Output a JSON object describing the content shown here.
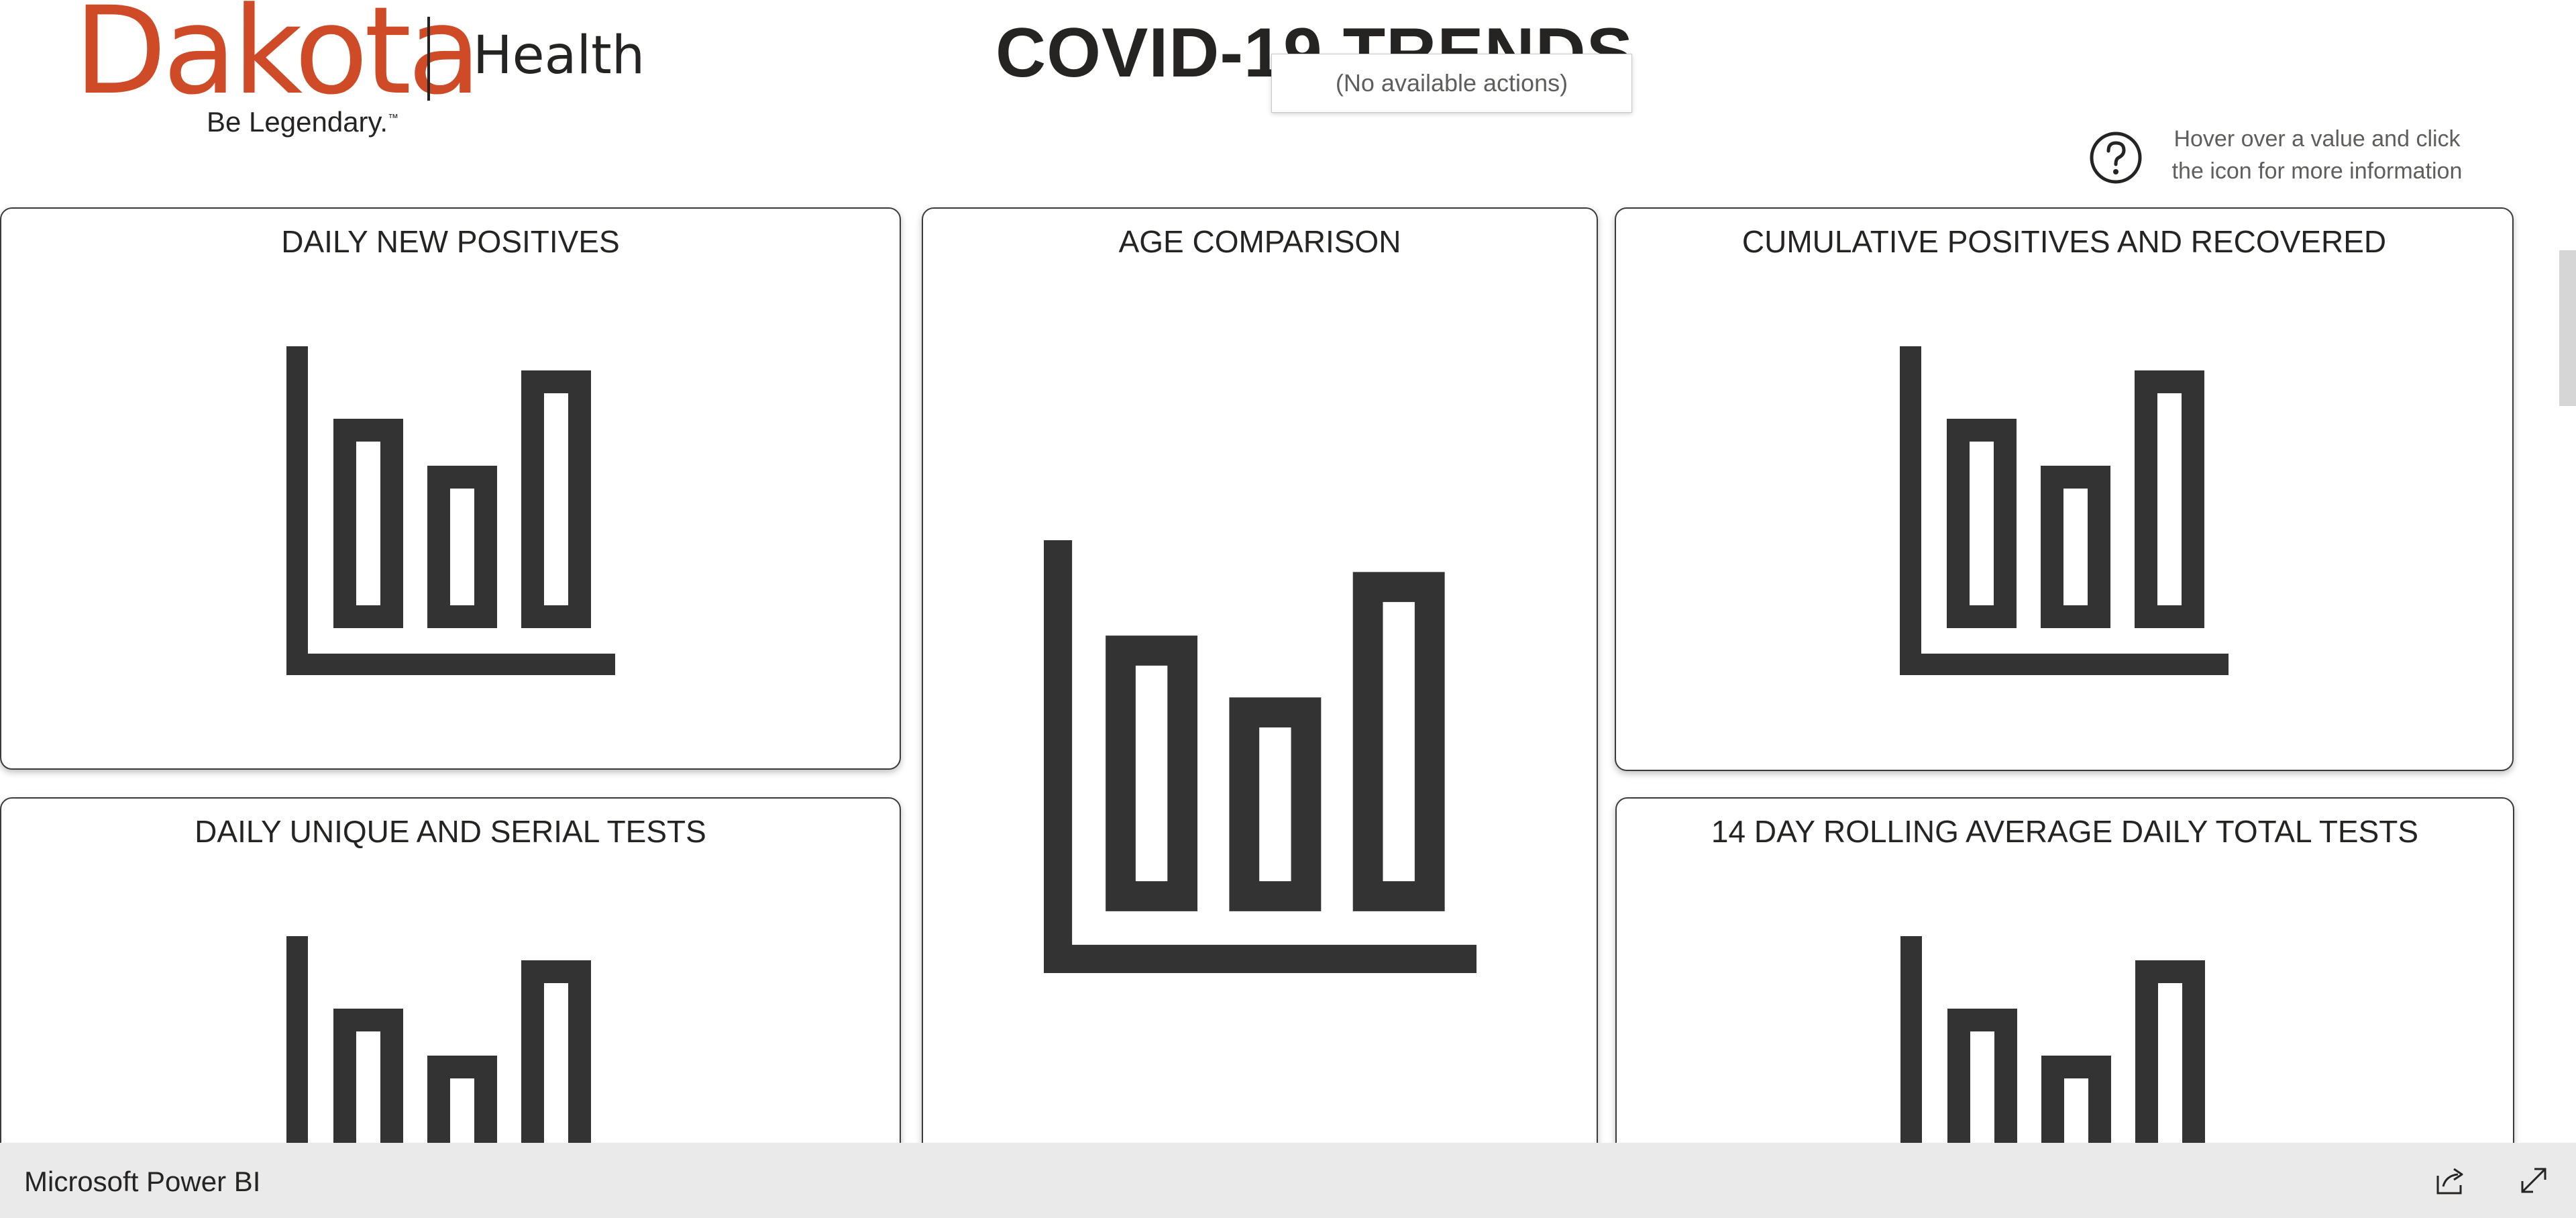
{
  "header": {
    "logo_brand": "Dakota",
    "logo_sub": "Health",
    "logo_tagline": "Be Legendary.",
    "logo_trademark": "™",
    "title": "COVID-19 TRENDS"
  },
  "tooltip": {
    "text": "(No available actions)"
  },
  "help": {
    "icon": "question-circle-icon",
    "text": "Hover over a value and click the icon for more information"
  },
  "cards": [
    {
      "title": "DAILY NEW POSITIVES",
      "icon": "bar-chart-placeholder-icon"
    },
    {
      "title": "AGE COMPARISON",
      "icon": "bar-chart-placeholder-icon"
    },
    {
      "title": "CUMULATIVE POSITIVES AND RECOVERED",
      "icon": "bar-chart-placeholder-icon"
    },
    {
      "title": "DAILY UNIQUE AND SERIAL TESTS",
      "icon": "bar-chart-placeholder-icon"
    },
    {
      "title": "14 DAY ROLLING AVERAGE DAILY TOTAL TESTS",
      "icon": "bar-chart-placeholder-icon"
    }
  ],
  "statusbar": {
    "app_name": "Microsoft Power BI",
    "share_icon": "share-icon",
    "expand_icon": "expand-icon"
  },
  "colors": {
    "brand": "#cf4a26",
    "text": "#252423",
    "icon": "#333333",
    "statusbar": "#eaeaea"
  }
}
